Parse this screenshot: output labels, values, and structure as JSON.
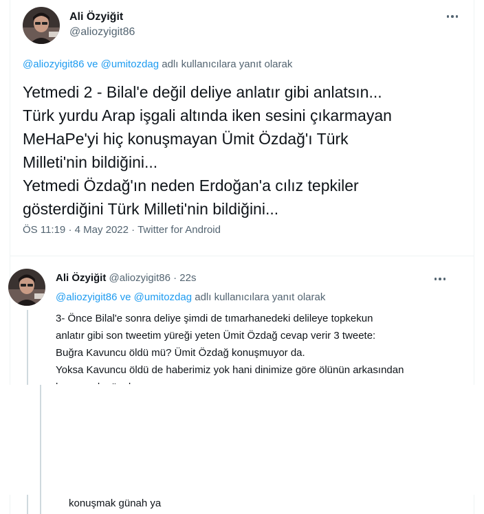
{
  "focused_tweet": {
    "author_name": "Ali Özyiğit",
    "author_handle": "@aliozyigit86",
    "reply_to_handles": [
      "@aliozyigit86",
      "@umitozdag"
    ],
    "reply_to_joiner": "ve",
    "reply_to_suffix": "adlı kullanıcılara yanıt olarak",
    "text_lines": [
      "Yetmedi 2 - Bilal'e değil deliye anlatır gibi anlatsın...",
      "Türk yurdu Arap işgali altında iken sesini çıkarmayan",
      "MeHaPe'yi hiç konuşmayan Ümit Özdağ'ı Türk",
      "Milleti'nin bildiğini...",
      "Yetmedi Özdağ'ın neden Erdoğan'a cılız tepkiler",
      "gösterdiğini Türk Milleti'nin bildiğini..."
    ],
    "time": "ÖS 11:19",
    "date": "4 May 2022",
    "source": "Twitter for Android",
    "meta_separator": "·"
  },
  "reply_tweet": {
    "author_name": "Ali Özyiğit",
    "author_handle": "@aliozyigit86",
    "separator": "·",
    "time": "22s",
    "reply_to_handles": [
      "@aliozyigit86",
      "@umitozdag"
    ],
    "reply_to_joiner": "ve",
    "reply_to_suffix": "adlı kullanıcılara yanıt olarak",
    "text_lines": [
      "3- Önce Bilal'e sonra deliye şimdi de tımarhanedeki delileye topkekun",
      "anlatır gibi son tweetim yüreği yeten Ümit Özdağ cevap verir 3 tweete:",
      "Buğra Kavuncu öldü mü? Ümit Özdağ konuşmuyor da.",
      "Yoksa Kavuncu öldü de haberimiz yok hani dinimize göre ölünün arkasından",
      "konuşmak günah ya"
    ],
    "bottom_visible_text": "konuşmak günah ya"
  },
  "icons": {
    "more": "more-horizontal-icon",
    "avatar": "user-avatar"
  }
}
